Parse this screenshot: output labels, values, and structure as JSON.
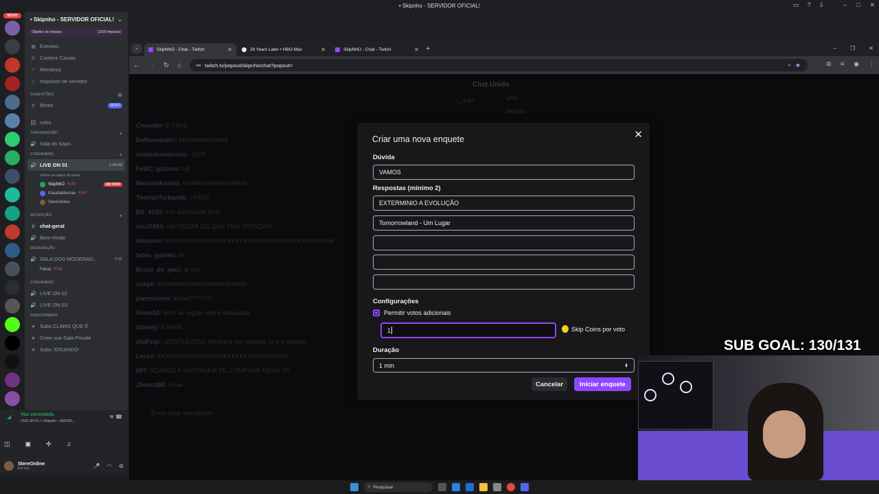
{
  "discord": {
    "window_title": "• Skipnho - SERVIDOR OFICIAL!",
    "novo_badge": "NOVO",
    "server": {
      "name": "• Skipnho - SERVIDOR OFICIAL!",
      "boost_label": "Objetivo de impulso",
      "boost_count": "12/20 Impulsos",
      "links": [
        "Eventos",
        "Conferir Canais",
        "Membros",
        "Impulsos de servidor"
      ]
    },
    "suggestions_label": "Sugestões",
    "filmes": "filmes",
    "novo_pill": "NOVO",
    "rules": "rules",
    "cat_transmissao": "TRANSMISSÃO",
    "sala_do_sapo": "Sala do Sapo",
    "cat_streamers": "STREAMERS",
    "live_on_01": "LIVE ON 01",
    "live_on_01_timer": "1:55:49",
    "live_status": "Defina um status do canal",
    "voice_users": [
      {
        "name": "SkipNhO",
        "tag": "FUX",
        "live": "AO VIVO"
      },
      {
        "name": "KlaudiaMamae",
        "tag": "FUX"
      },
      {
        "name": "StereOnline"
      }
    ],
    "cat_recepcao": "Recepção",
    "chat_geral": "chat-geral",
    "bem_vindo": "Bem-Vindo",
    "cat_moderacao": "MODERAÇÃO",
    "sala_moderadores": "SALA DOS MODERAD...",
    "sala_mod_timer": "0:50",
    "febas": "Febas",
    "febas_tag": "FUX",
    "cat_streamers2": "STREAMERS",
    "live_on_02": "LIVE ON 02",
    "live_on_03": "LIVE ON 03",
    "cat_subscribers": "Subscribers",
    "subs_claro": "Subs CLARO QUE É",
    "crie_sala": "Criee sua Sala Private",
    "subs_jogando": "Subs JOGANDO",
    "voice_connected": "Voz conectada",
    "voice_channel": "LIVE ON 01 / • Skipnho - SERVID...",
    "user": {
      "name": "StereOnline",
      "status": "Em voz"
    }
  },
  "browser": {
    "tabs": [
      {
        "title": "SkipNhO - Chat - Twitch",
        "active": true
      },
      {
        "title": "28 Years Later • HBO Max",
        "active": false
      },
      {
        "title": "SkipNhO - Chat - Twitch",
        "active": false
      }
    ],
    "url": "twitch.tv/popout/skipnho/chat?popout="
  },
  "twitch": {
    "chat_header": "Chat Unido",
    "leaders": [
      "r_da8a",
      "g4tts",
      "felpz09"
    ],
    "chat_lines": [
      {
        "user": "Chowder:",
        "msg": "E FAKE"
      },
      {
        "user": "DaNoontador:",
        "msg": "kkkkkkkkkkkkkkkk"
      },
      {
        "user": "natandeandenisc:",
        "msg": "-1000"
      },
      {
        "user": "FelliC_gstcnts:",
        "msg": "UÉ"
      },
      {
        "user": "MarceloKastro:",
        "msg": "kkkkkkkkkkkkkkkkkkkkk"
      },
      {
        "user": "ThoriseTurbando_:",
        "msg": "FAKE"
      },
      {
        "user": "BS_4120:",
        "msg": "voz adulterada BAN"
      },
      {
        "user": "cmJA895:",
        "msg": "NA REGRA DIZ QUE TEM VOTAÇAO"
      },
      {
        "user": "drezeroc:",
        "msg": "KKKKKKKKKKKKKKKKKKKKKKKKKKKKKKKKKKKKKKKKK"
      },
      {
        "user": "fabio_gabriel:",
        "msg": "IA"
      },
      {
        "user": "Brasil_do_paci:",
        "msg": "ai sim"
      },
      {
        "user": "uxxpe:",
        "msg": "kkkkkkkkkkkkkkkkkkkkkkkkkkkkk"
      },
      {
        "user": "pierrossem:",
        "msg": "febas???????"
      },
      {
        "user": "Voinn18:",
        "msg": "abra as regras skip e leiaaaaaa"
      },
      {
        "user": "xDewly:",
        "msg": "É FAKE."
      },
      {
        "user": "ziiaFeijc:",
        "msg": "@ESTUDIOSO Mostra a voz original, tu n é homem"
      },
      {
        "user": "Lece1:",
        "msg": "KKKKKKKKKKKKKKKKKKKKKKKKKKKKKKKK"
      },
      {
        "user": "ti07:",
        "msg": "ACABOU A VANTAGEM DE COMPRAR FILME TÁ"
      },
      {
        "user": "Jhoon360:",
        "msg": "issae"
      }
    ],
    "send_placeholder": "Envie uma mensagem"
  },
  "poll_modal": {
    "title": "Criar uma nova enquete",
    "question_label": "Dúvida",
    "question_value": "VAMOS",
    "answers_label": "Respostas (mínimo 2)",
    "answers": [
      "EXTERMINIO A EVOLUÇÃO",
      "Tomorrowland - Um Lugar",
      "",
      "",
      ""
    ],
    "settings_label": "Configurações",
    "allow_extra_votes": "Permitir votos adicionais",
    "allow_extra_checked": true,
    "coins_value": "1",
    "coins_label": "Skip Coins por voto",
    "duration_label": "Duração",
    "duration_value": "1 min",
    "cancel": "Cancelar",
    "start": "Iniciar enquete"
  },
  "overlay": {
    "sub_goal": "SUB GOAL: 130/131"
  },
  "taskbar": {
    "search_placeholder": "Pesquisar"
  }
}
